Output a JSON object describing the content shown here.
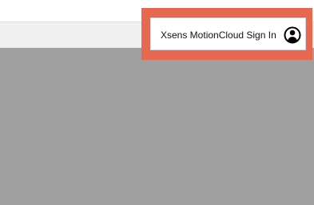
{
  "app": {
    "signin_button_label": "Xsens MotionCloud Sign In",
    "user_icon": "user-circle-icon"
  },
  "colors": {
    "highlight": "#e8674f",
    "content_background": "#a0a0a0",
    "toolbar_background": "#f0f0f0"
  }
}
